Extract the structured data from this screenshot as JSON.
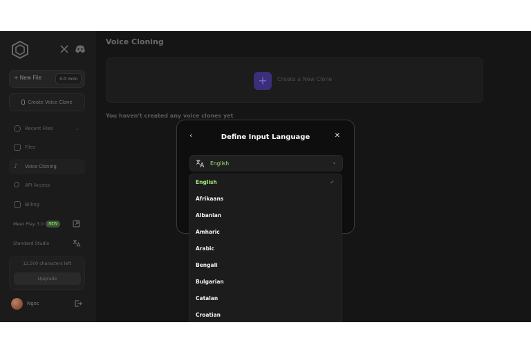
{
  "sidebar": {
    "new_file_label": "+ New File",
    "version": "3.0 mini",
    "create_clone_label": "Create Voice Clone",
    "nav": [
      {
        "label": "Recent Files"
      },
      {
        "label": "Files"
      },
      {
        "label": "Voice Cloning"
      },
      {
        "label": "API Access"
      },
      {
        "label": "Billing"
      }
    ],
    "meet_play": "Meet Play 3.0",
    "new_badge": "NEW",
    "standard_studio": "Standard Studio",
    "credits": "12,500 characters left",
    "upgrade": "Upgrade",
    "username": "Ngoc"
  },
  "main": {
    "title": "Voice Cloning",
    "create_clone": "Create a New Clone",
    "empty_message": "You haven't created any voice clones yet"
  },
  "modal": {
    "title": "Define Input Language",
    "selected": "English"
  },
  "languages": [
    "English",
    "Afrikaans",
    "Albanian",
    "Amharic",
    "Arabic",
    "Bengali",
    "Bulgarian",
    "Catalan",
    "Croatian"
  ],
  "colors": {
    "accent_green": "#a6e47c",
    "accent_purple": "#3b2f7a",
    "modal_bg": "#0e0e0e"
  },
  "icons": [
    "logo-icon",
    "x-twitter-icon",
    "discord-icon",
    "microphone-icon",
    "clock-icon",
    "folder-icon",
    "voice-icon",
    "key-icon",
    "card-icon",
    "external-link-icon",
    "translate-icon",
    "logout-icon",
    "plus-icon",
    "back-icon",
    "close-icon",
    "chevron-down-icon",
    "check-icon"
  ]
}
